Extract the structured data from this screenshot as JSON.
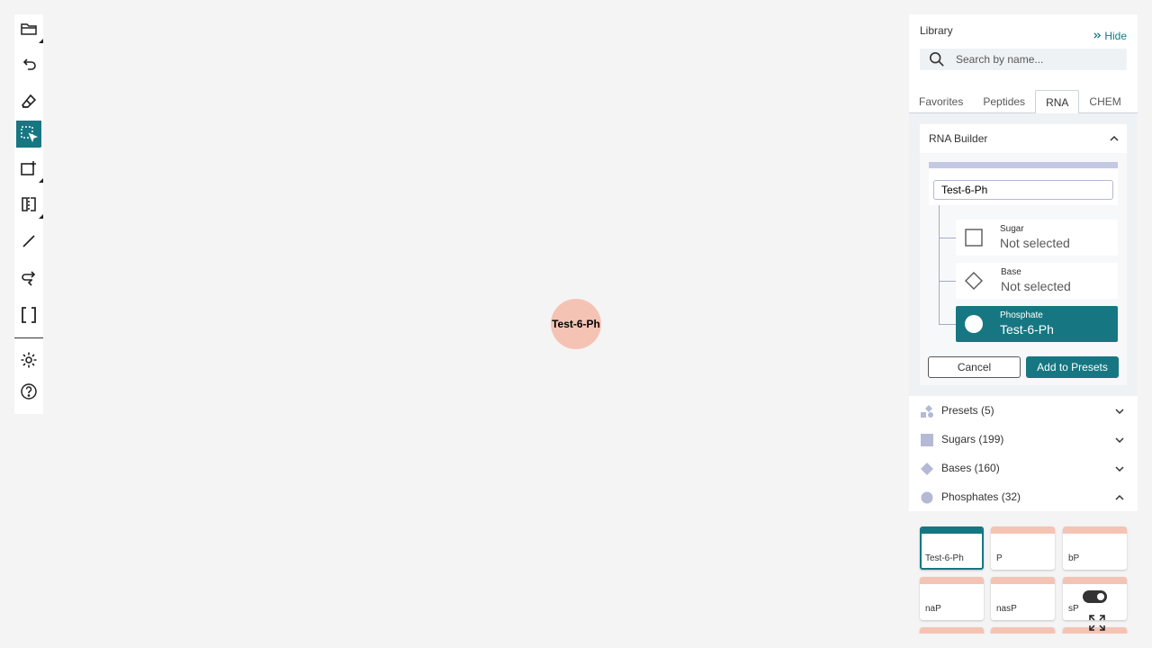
{
  "toolbar": {
    "tools": [
      {
        "name": "open-file-icon"
      },
      {
        "name": "undo-icon"
      },
      {
        "name": "erase-icon"
      },
      {
        "name": "select-rectangle-icon",
        "active": true
      },
      {
        "name": "add-monomer-icon"
      },
      {
        "name": "flip-icon"
      },
      {
        "name": "single-bond-icon"
      },
      {
        "name": "antisense-icon"
      },
      {
        "name": "brackets-icon"
      },
      {
        "name": "settings-icon"
      },
      {
        "name": "help-icon"
      }
    ]
  },
  "canvas": {
    "monomer_label": "Test-6-Ph"
  },
  "library": {
    "title": "Library",
    "hide_label": "Hide",
    "search_placeholder": "Search by name...",
    "tabs": [
      "Favorites",
      "Peptides",
      "RNA",
      "CHEM"
    ],
    "active_tab": "RNA",
    "rna_builder": {
      "title": "RNA Builder",
      "name_value": "Test-6-Ph",
      "sugar": {
        "label": "Sugar",
        "value": "Not selected"
      },
      "base": {
        "label": "Base",
        "value": "Not selected"
      },
      "phosphate": {
        "label": "Phosphate",
        "value": "Test-6-Ph"
      },
      "cancel_label": "Cancel",
      "add_label": "Add to Presets"
    },
    "groups": {
      "presets": "Presets (5)",
      "sugars": "Sugars (199)",
      "bases": "Bases (160)",
      "phosphates": "Phosphates (32)"
    },
    "phosphate_cards": [
      "Test-6-Ph",
      "P",
      "bP",
      "naP",
      "nasP",
      "sP"
    ]
  },
  "colors": {
    "accent": "#167782",
    "phosphate_fill": "#f5c3b4",
    "builder_accent": "#c5c8e3",
    "group_icon": "#b4b9d6"
  }
}
